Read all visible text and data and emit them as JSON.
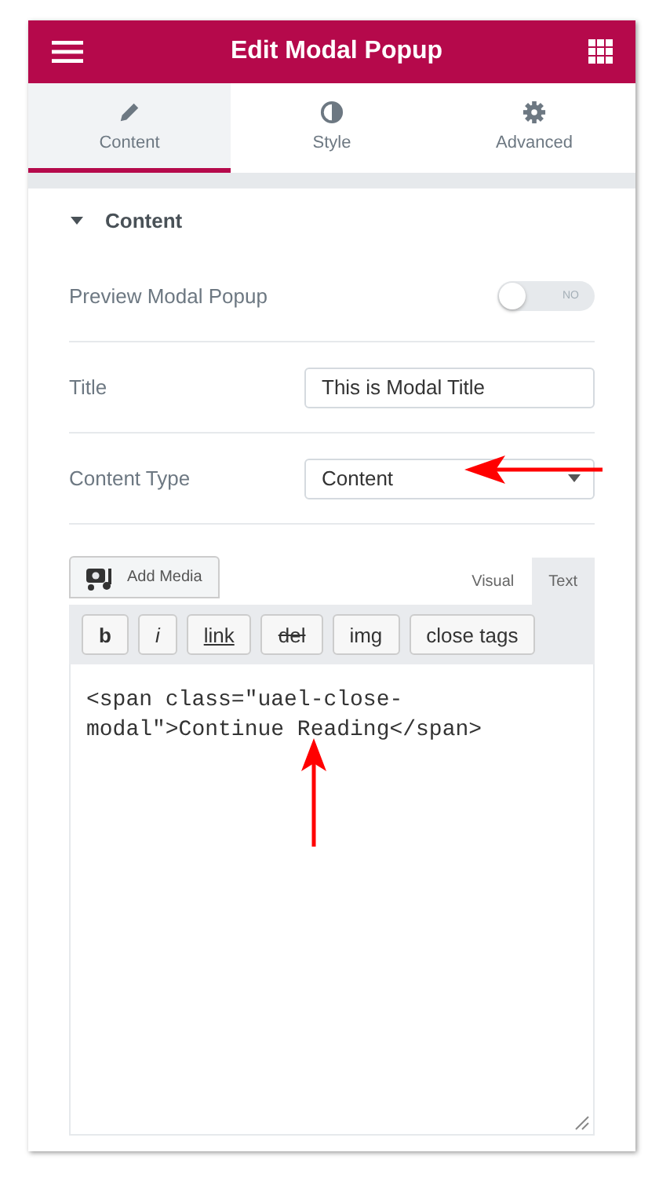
{
  "header": {
    "title": "Edit Modal Popup"
  },
  "tabs": [
    {
      "label": "Content",
      "selected": true
    },
    {
      "label": "Style",
      "selected": false
    },
    {
      "label": "Advanced",
      "selected": false
    }
  ],
  "section": {
    "title": "Content",
    "expanded": true
  },
  "fields": [
    {
      "kind": "toggle",
      "label": "Preview Modal Popup",
      "on": false,
      "toggle_text": "NO"
    },
    {
      "kind": "text",
      "label": "Title",
      "value": "This is Modal Title"
    },
    {
      "kind": "select",
      "label": "Content Type",
      "value": "Content"
    }
  ],
  "editor": {
    "add_media": "Add Media",
    "modes": [
      {
        "label": "Visual",
        "selected": false
      },
      {
        "label": "Text",
        "selected": true
      }
    ],
    "quicktags": [
      {
        "label": "b",
        "kind": "bold"
      },
      {
        "label": "i",
        "kind": "italic"
      },
      {
        "label": "link",
        "kind": "link"
      },
      {
        "label": "del",
        "kind": "del"
      },
      {
        "label": "img",
        "kind": "plain"
      },
      {
        "label": "close tags",
        "kind": "plain"
      }
    ],
    "code": "<span class=\"uael-close-modal\">Continue Reading</span>"
  }
}
